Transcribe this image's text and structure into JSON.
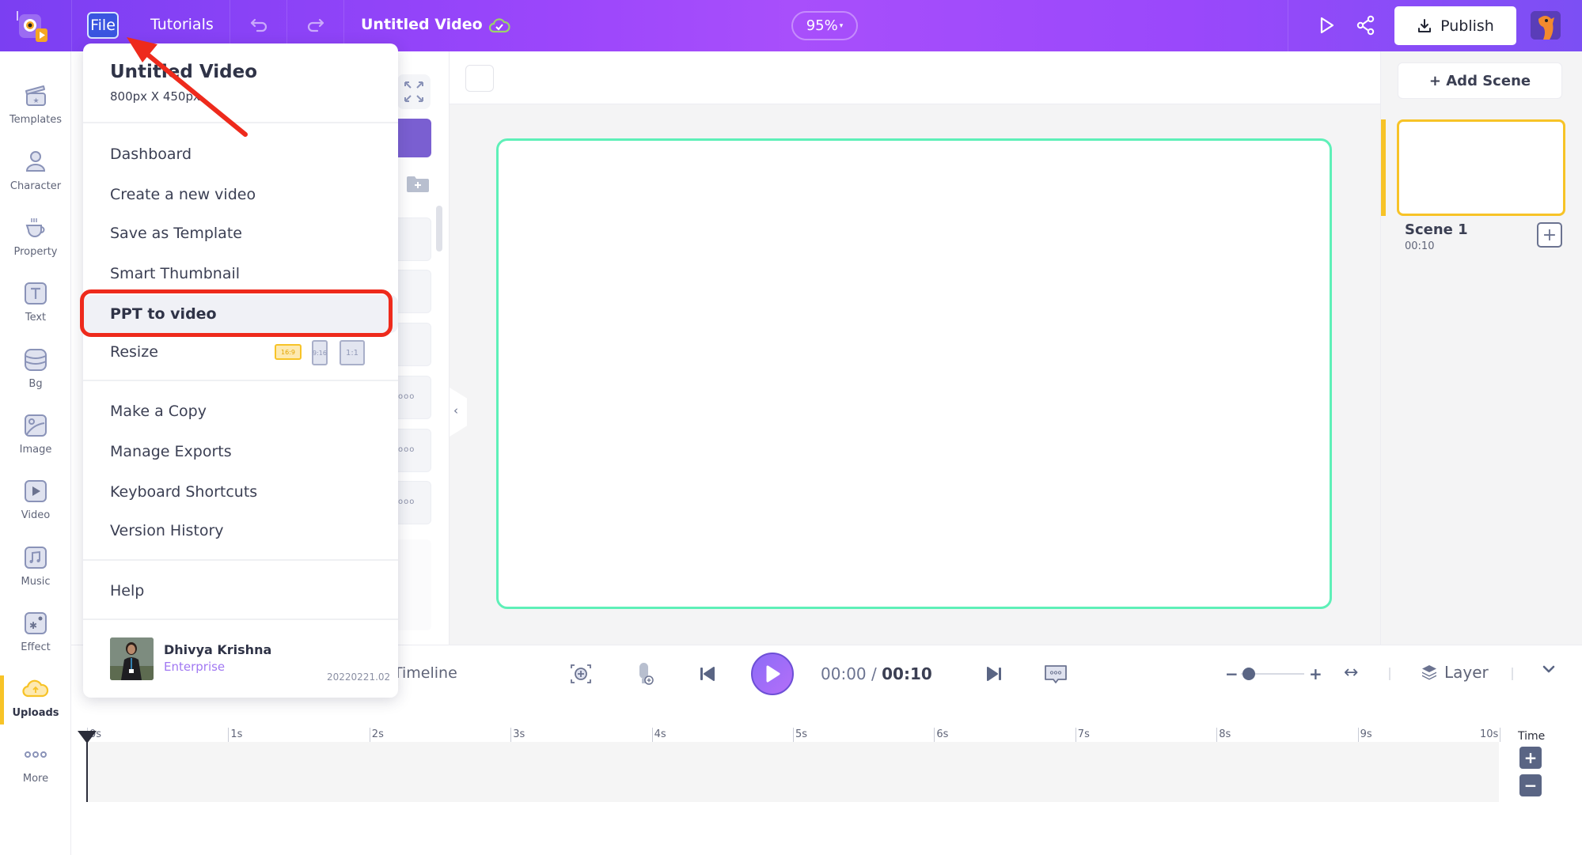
{
  "topbar": {
    "file_label": "File",
    "tutorials_label": "Tutorials",
    "undo_icon": "undo-icon",
    "redo_icon": "redo-icon",
    "video_title": "Untitled Video",
    "save_status_icon": "cloud-check-icon",
    "zoom_value": "95%",
    "zoom_caret": "▾",
    "publish_label": "Publish",
    "colors": {
      "gradient_start": "#7b3ff2",
      "gradient_mid": "#a84ffb",
      "publish_bg": "#ffffff"
    }
  },
  "sidebar": {
    "active": "Uploads",
    "accent": "#f7c327",
    "items": [
      {
        "label": "Templates",
        "icon": "clapperboard-icon"
      },
      {
        "label": "Character",
        "icon": "person-icon"
      },
      {
        "label": "Property",
        "icon": "coffee-cup-icon"
      },
      {
        "label": "Text",
        "icon": "text-t-icon"
      },
      {
        "label": "Bg",
        "icon": "layers-wave-icon"
      },
      {
        "label": "Image",
        "icon": "image-icon"
      },
      {
        "label": "Video",
        "icon": "video-play-icon"
      },
      {
        "label": "Music",
        "icon": "music-note-icon"
      },
      {
        "label": "Effect",
        "icon": "sparkle-icon"
      },
      {
        "label": "Uploads",
        "icon": "cloud-upload-icon"
      },
      {
        "label": "More",
        "icon": "more-dots-icon"
      }
    ]
  },
  "file_menu": {
    "title": "Untitled Video",
    "dimensions": "800px X 450px",
    "items": [
      {
        "label": "Dashboard"
      },
      {
        "label": "Create a new video"
      },
      {
        "label": "Save as Template"
      },
      {
        "label": "Smart Thumbnail"
      },
      {
        "label": "PPT to video",
        "highlighted": true
      },
      {
        "label": "Resize"
      },
      {
        "label": "Make a Copy"
      },
      {
        "label": "Manage Exports"
      },
      {
        "label": "Keyboard Shortcuts"
      },
      {
        "label": "Version History"
      },
      {
        "label": "Help"
      }
    ],
    "resize_options": [
      {
        "label": "16:9",
        "selected": true
      },
      {
        "label": "9:16",
        "selected": false
      },
      {
        "label": "1:1",
        "selected": false
      }
    ],
    "user": {
      "name": "Dhivya Krishna",
      "plan": "Enterprise"
    },
    "version": "20220221.02",
    "highlight_color": "#ee2a1c"
  },
  "panel": {
    "card_more": "ooo"
  },
  "canvas": {
    "border_color": "#5ef0b8"
  },
  "scenes": {
    "add_label": "+ Add Scene",
    "items": [
      {
        "name": "Scene 1",
        "duration": "00:10",
        "selected": true
      }
    ],
    "add_icon": "+"
  },
  "timeline": {
    "label": "Timeline",
    "current_time": "00:00",
    "separator": "/",
    "total_time": "00:10",
    "layer_label": "Layer",
    "zoom_level": 0.1,
    "ticks": [
      "0s",
      "1s",
      "2s",
      "3s",
      "4s",
      "5s",
      "6s",
      "7s",
      "8s",
      "9s",
      "10s"
    ],
    "time_label": "Time",
    "time_plus": "+",
    "time_minus": "−",
    "slider_minus": "−",
    "slider_plus": "+"
  }
}
